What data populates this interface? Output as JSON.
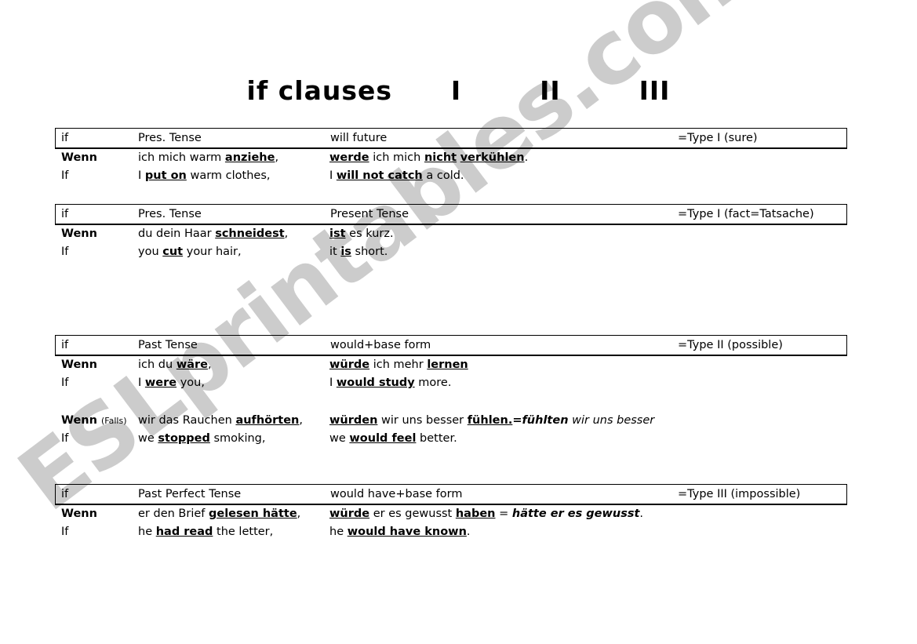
{
  "title": "if clauses      I        II        III",
  "watermark": {
    "text": "ESLprintables.com",
    "color": "#cccccc"
  },
  "blocks": [
    {
      "header": {
        "c1": "if",
        "c2": "Pres. Tense",
        "c3": "will future",
        "c4": "=Type I (sure)"
      },
      "rows": [
        {
          "lang": "de",
          "c1": "Wenn",
          "c2_html": "ich mich warm <span class=\"bu\">anziehe</span>,",
          "c3_html": "<span class=\"bu\">werde</span> ich mich <span class=\"bu\">nicht</span> <span class=\"bu\">verkühlen</span>."
        },
        {
          "lang": "en",
          "c1": "If",
          "c2_html": "I <span class=\"bu\">put on</span> warm clothes,",
          "c3_html": "I <span class=\"bu\">will not catch</span> a cold."
        }
      ]
    },
    {
      "header": {
        "c1": "if",
        "c2": "Pres. Tense",
        "c3": "Present Tense",
        "c4": "=Type I (fact=Tatsache)"
      },
      "rows": [
        {
          "lang": "de",
          "c1": "Wenn",
          "c2_html": "du dein Haar <span class=\"bu\">schneidest</span>,",
          "c3_html": "<span class=\"bu\">ist</span> es kurz."
        },
        {
          "lang": "en",
          "c1": "If",
          "c2_html": "you <span class=\"bu\">cut</span> your hair,",
          "c3_html": "it <span class=\"bu\">is</span> short."
        }
      ]
    },
    {
      "header": {
        "c1": "if",
        "c2": "Past Tense",
        "c3": "would+base form",
        "c4": "=Type II (possible)"
      },
      "rows": [
        {
          "lang": "de",
          "c1": "Wenn",
          "c2_html": "ich du <span class=\"bu\">wäre</span>,",
          "c3_html": "<span class=\"bu\">würde</span> ich mehr <span class=\"bu\">lernen</span>"
        },
        {
          "lang": "en",
          "c1": "If",
          "c2_html": "I <span class=\"bu\">were</span> you,",
          "c3_html": "I <span class=\"bu\">would study</span> more."
        },
        {
          "lang": "gap"
        },
        {
          "lang": "de",
          "c1_html": "Wenn <span class=\"small\">(Falls)</span>",
          "c2_html": "wir das Rauchen <span class=\"bu\">aufhörten</span>,",
          "c3_html": "<span class=\"bu\">würden</span> wir uns besser <span class=\"bu\">fühlen.</span><span class=\"b\">=</span><span class=\"bi\">fühlten</span> <span class=\"i\">wir uns besser</span>"
        },
        {
          "lang": "en",
          "c1": "If",
          "c2_html": "we <span class=\"bu\">stopped</span> smoking,",
          "c3_html": "we <span class=\"bu\">would feel</span> better."
        }
      ]
    },
    {
      "header": {
        "c1": "if",
        "c2": "Past Perfect Tense",
        "c3": "would have+base form",
        "c4": "=Type III (impossible)"
      },
      "rows": [
        {
          "lang": "de",
          "c1": "Wenn",
          "c2_html": "er den Brief <span class=\"bu\">gelesen hätte</span>,",
          "c3_html": "<span class=\"bu\">würde</span> er es gewusst <span class=\"bu\">haben</span> = <span class=\"bi\">hätte er es gewusst</span>."
        },
        {
          "lang": "en",
          "c1": "If",
          "c2_html": "he <span class=\"bu\">had read</span> the letter,",
          "c3_html": "he <span class=\"bu\">would have known</span>."
        }
      ]
    }
  ]
}
